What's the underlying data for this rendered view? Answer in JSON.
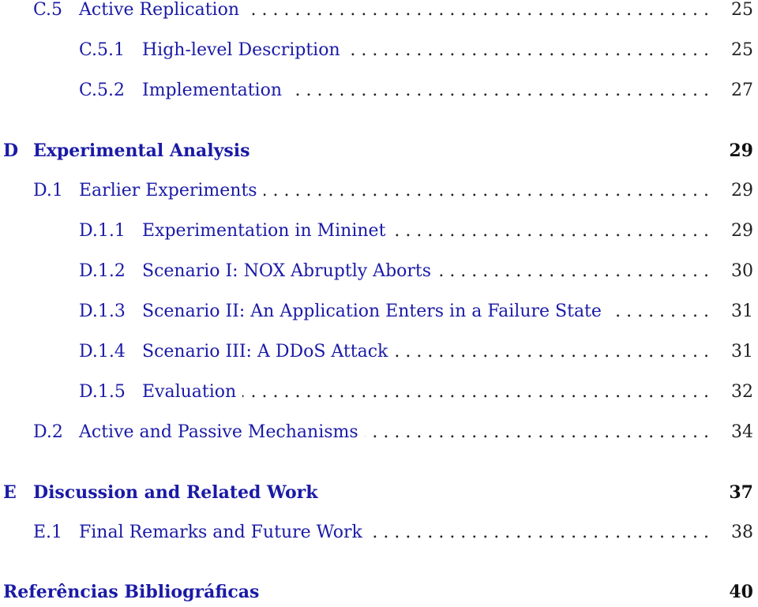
{
  "toc": [
    {
      "level": 2,
      "number": "C.5",
      "title": "Active Replication",
      "page": "25"
    },
    {
      "level": 3,
      "number": "C.5.1",
      "title": "High-level Description",
      "page": "25"
    },
    {
      "level": 3,
      "number": "C.5.2",
      "title": "Implementation",
      "page": "27"
    },
    {
      "level": 1,
      "number": "D",
      "title": "Experimental Analysis",
      "page": "29"
    },
    {
      "level": 2,
      "number": "D.1",
      "title": "Earlier Experiments",
      "page": "29"
    },
    {
      "level": 3,
      "number": "D.1.1",
      "title": "Experimentation in Mininet",
      "page": "29"
    },
    {
      "level": 3,
      "number": "D.1.2",
      "title": "Scenario I: NOX Abruptly Aborts",
      "page": "30"
    },
    {
      "level": 3,
      "number": "D.1.3",
      "title": "Scenario II: An Application Enters in a Failure State",
      "page": "31"
    },
    {
      "level": 3,
      "number": "D.1.4",
      "title": "Scenario III: A DDoS Attack",
      "page": "31"
    },
    {
      "level": 3,
      "number": "D.1.5",
      "title": "Evaluation",
      "page": "32"
    },
    {
      "level": 2,
      "number": "D.2",
      "title": "Active and Passive Mechanisms",
      "page": "34"
    },
    {
      "level": 1,
      "number": "E",
      "title": "Discussion and Related Work",
      "page": "37"
    },
    {
      "level": 2,
      "number": "E.1",
      "title": "Final Remarks and Future Work",
      "page": "38"
    },
    {
      "level": 0,
      "number": "",
      "title": "Referências Bibliográficas",
      "page": "40"
    }
  ],
  "colors": {
    "link": "#1a1aa6",
    "text": "#222222"
  }
}
